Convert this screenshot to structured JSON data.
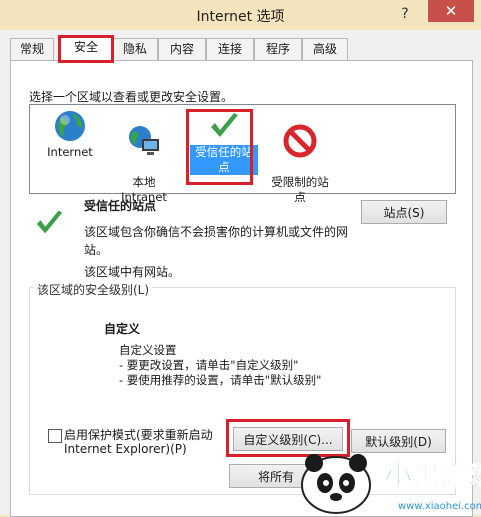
{
  "window": {
    "title": "Internet 选项",
    "help": "?",
    "close": "✕"
  },
  "tabs": [
    "常规",
    "安全",
    "隐私",
    "内容",
    "连接",
    "程序",
    "高级"
  ],
  "prompt": "选择一个区域以查看或更改安全设置。",
  "zones": [
    {
      "label": "Internet",
      "icon": "globe-icon"
    },
    {
      "label": "本地\nIntranet",
      "icon": "intranet-icon"
    },
    {
      "label": "受信任的站点",
      "icon": "checkmark-icon",
      "selected": true
    },
    {
      "label": "受限制的站\n点",
      "icon": "forbidden-icon"
    }
  ],
  "zone_info": {
    "title": "受信任的站点",
    "desc1": "该区域包含你确信不会损害你的计算机或文件的网",
    "desc2": "站。",
    "note": "该区域中有网站。",
    "sites_button": "站点(S)"
  },
  "security_level": {
    "group_label": "该区域的安全级别(L)",
    "heading": "自定义",
    "line1": "自定义设置",
    "line2": "- 要更改设置，请单击\"自定义级别\"",
    "line3": "- 要使用推荐的设置，请单击\"默认级别\""
  },
  "protected_mode": {
    "line1": "启用保护模式(要求重新启动",
    "line2": "Internet Explorer)(P)",
    "checked": false
  },
  "buttons": {
    "custom_level": "自定义级别(C)...",
    "default_level": "默认级别(D)",
    "reset_all": "将所有"
  },
  "watermark": {
    "text": "小黑游戏",
    "url": "www.xiaohei.com"
  },
  "colors": {
    "highlight": "#d9202a",
    "selection": "#3399ff",
    "titlebar": "#f4e4bd"
  }
}
